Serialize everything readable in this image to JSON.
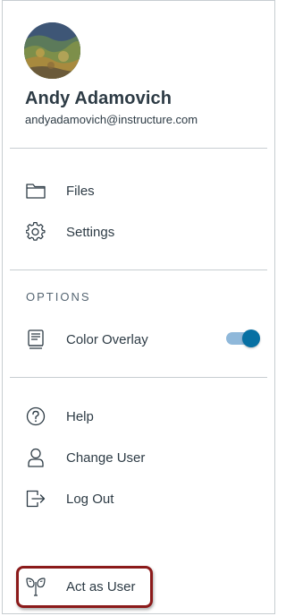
{
  "user": {
    "name": "Andy Adamovich",
    "email": "andyadamovich@instructure.com"
  },
  "menu": {
    "files": "Files",
    "settings": "Settings"
  },
  "options": {
    "title": "OPTIONS",
    "color_overlay": {
      "label": "Color Overlay",
      "enabled": true
    }
  },
  "account": {
    "help": "Help",
    "change_user": "Change User",
    "log_out": "Log Out",
    "act_as_user": "Act as User"
  },
  "colors": {
    "text": "#2d3b45",
    "divider": "#c7cdd1",
    "toggle_on": "#0770a3",
    "highlight_border": "#8b1a1a"
  }
}
